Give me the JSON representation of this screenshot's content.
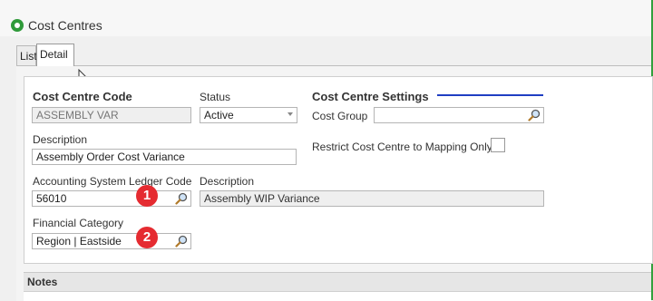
{
  "window": {
    "title": "Cost Centres",
    "accent": "#33a03d"
  },
  "tabs": [
    {
      "label": "List"
    },
    {
      "label": "Detail"
    }
  ],
  "form": {
    "code_label": "Cost Centre Code",
    "code_value": "ASSEMBLY VAR",
    "status_label": "Status",
    "status_value": "Active",
    "settings_label": "Cost Centre Settings",
    "description_label": "Description",
    "description_value": "Assembly Order Cost Variance",
    "cost_group_label": "Cost Group",
    "cost_group_value": "",
    "restrict_label": "Restrict Cost Centre to Mapping Only",
    "ledger_label": "Accounting System Ledger Code",
    "ledger_value": "56010",
    "ledger_desc_label": "Description",
    "ledger_desc_value": "Assembly WIP Variance",
    "fin_cat_label": "Financial Category",
    "fin_cat_value": "Region | Eastside",
    "notes_label": "Notes"
  },
  "badges": [
    {
      "label": "1"
    },
    {
      "label": "2"
    }
  ],
  "icons": {
    "lookup": "magnifier-icon",
    "combo": "chevron-down-icon",
    "app": "app-logo-icon",
    "cursor": "mouse-cursor-icon"
  },
  "colors": {
    "badge": "#e52b31",
    "settings_line": "#1f3ec2"
  }
}
